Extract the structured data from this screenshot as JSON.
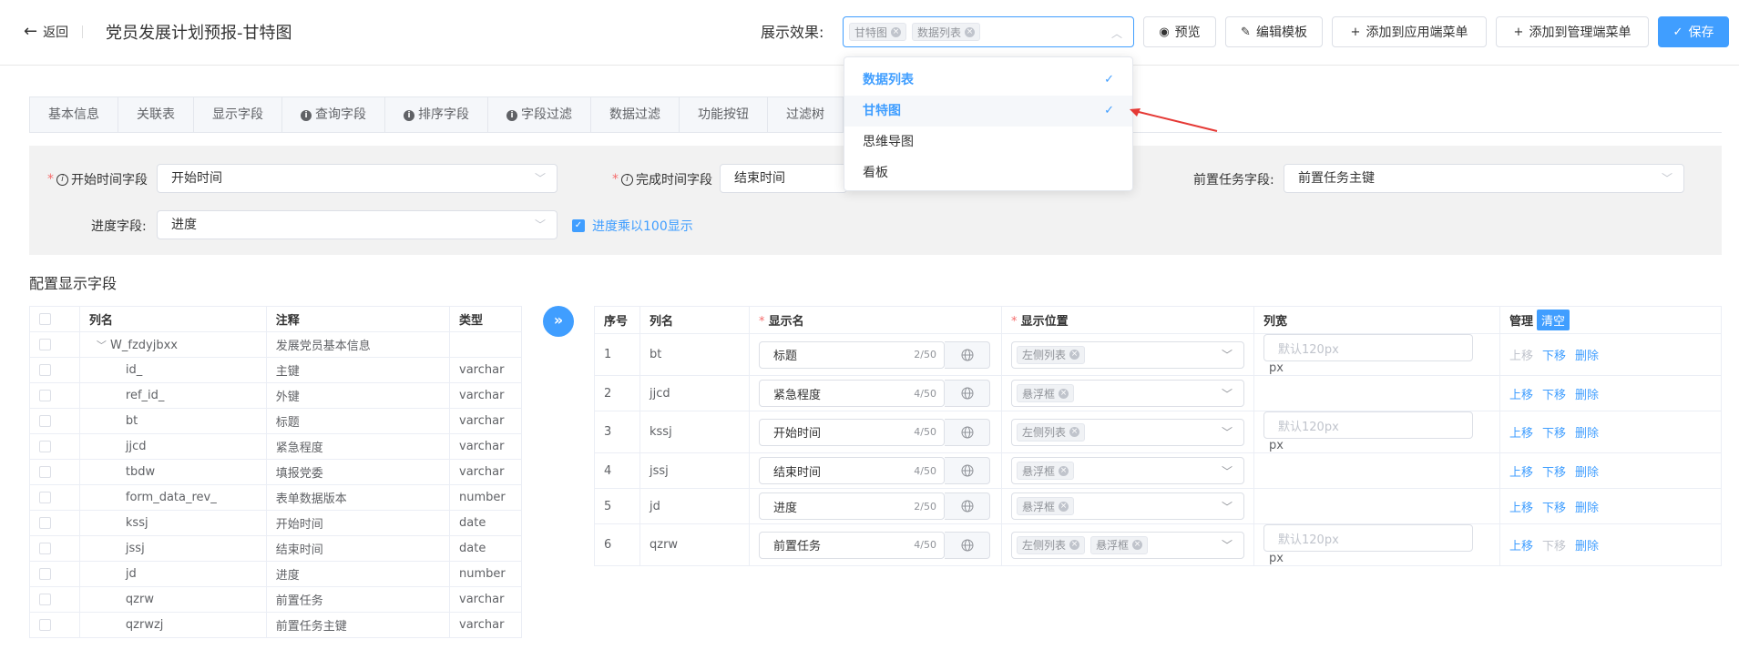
{
  "header": {
    "back_label": "返回",
    "title": "党员发展计划预报-甘特图",
    "display_label": "展示效果:",
    "selected_tags": [
      "甘特图",
      "数据列表"
    ],
    "preview_label": "预览",
    "edit_template_label": "编辑模板",
    "add_app_menu_label": "添加到应用端菜单",
    "add_admin_menu_label": "添加到管理端菜单",
    "save_label": "保存"
  },
  "dropdown": {
    "options": [
      {
        "label": "数据列表",
        "selected": true
      },
      {
        "label": "甘特图",
        "selected": true
      },
      {
        "label": "思维导图",
        "selected": false
      },
      {
        "label": "看板",
        "selected": false
      }
    ]
  },
  "tabs": [
    {
      "label": "基本信息",
      "info": false
    },
    {
      "label": "关联表",
      "info": false
    },
    {
      "label": "显示字段",
      "info": false
    },
    {
      "label": "查询字段",
      "info": true
    },
    {
      "label": "排序字段",
      "info": true
    },
    {
      "label": "字段过滤",
      "info": true
    },
    {
      "label": "数据过滤",
      "info": false
    },
    {
      "label": "功能按钮",
      "info": false
    },
    {
      "label": "过滤树",
      "info": false
    }
  ],
  "form": {
    "start_label": "开始时间字段",
    "start_value": "开始时间",
    "end_label": "完成时间字段",
    "end_value": "结束时间",
    "pre_label": "前置任务字段:",
    "pre_value": "前置任务主键",
    "progress_label": "进度字段:",
    "progress_value": "进度",
    "multiply_label": "进度乘以100显示"
  },
  "section_title": "配置显示字段",
  "left_table": {
    "headers": [
      "列名",
      "注释",
      "类型"
    ],
    "group": {
      "name": "W_fzdyjbxx",
      "comment": "发展党员基本信息"
    },
    "rows": [
      {
        "name": "id_",
        "comment": "主键",
        "type": "varchar"
      },
      {
        "name": "ref_id_",
        "comment": "外键",
        "type": "varchar"
      },
      {
        "name": "bt",
        "comment": "标题",
        "type": "varchar"
      },
      {
        "name": "jjcd",
        "comment": "紧急程度",
        "type": "varchar"
      },
      {
        "name": "tbdw",
        "comment": "填报党委",
        "type": "varchar"
      },
      {
        "name": "form_data_rev_",
        "comment": "表单数据版本",
        "type": "number"
      },
      {
        "name": "kssj",
        "comment": "开始时间",
        "type": "date"
      },
      {
        "name": "jssj",
        "comment": "结束时间",
        "type": "date"
      },
      {
        "name": "jd",
        "comment": "进度",
        "type": "number"
      },
      {
        "name": "qzrw",
        "comment": "前置任务",
        "type": "varchar"
      },
      {
        "name": "qzrwzj",
        "comment": "前置任务主键",
        "type": "varchar"
      }
    ]
  },
  "right_table": {
    "headers": {
      "index": "序号",
      "column": "列名",
      "display_name": "显示名",
      "position": "显示位置",
      "width": "列宽",
      "manage": "管理",
      "clear": "清空"
    },
    "width_placeholder": "默认120px",
    "px": "px",
    "ops": {
      "up": "上移",
      "down": "下移",
      "delete": "删除"
    },
    "rows": [
      {
        "index": "1",
        "column": "bt",
        "name": "标题",
        "count": "2/50",
        "positions": [
          "左侧列表"
        ],
        "has_width": true
      },
      {
        "index": "2",
        "column": "jjcd",
        "name": "紧急程度",
        "count": "4/50",
        "positions": [
          "悬浮框"
        ],
        "has_width": false
      },
      {
        "index": "3",
        "column": "kssj",
        "name": "开始时间",
        "count": "4/50",
        "positions": [
          "左侧列表"
        ],
        "has_width": true
      },
      {
        "index": "4",
        "column": "jssj",
        "name": "结束时间",
        "count": "4/50",
        "positions": [
          "悬浮框"
        ],
        "has_width": false
      },
      {
        "index": "5",
        "column": "jd",
        "name": "进度",
        "count": "2/50",
        "positions": [
          "悬浮框"
        ],
        "has_width": false
      },
      {
        "index": "6",
        "column": "qzrw",
        "name": "前置任务",
        "count": "4/50",
        "positions": [
          "左侧列表",
          "悬浮框"
        ],
        "has_width": true
      }
    ]
  },
  "colors": {
    "primary": "#409eff",
    "annotation_arrow": "#e53935"
  }
}
